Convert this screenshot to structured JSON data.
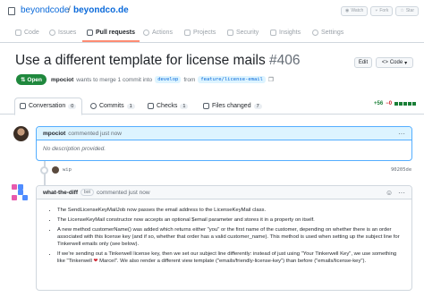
{
  "repo": {
    "owner": "beyondcode",
    "separator": "/",
    "name": "beyondco.de",
    "buttons": [
      "Watch",
      "Fork",
      "Star"
    ]
  },
  "repo_tabs": [
    {
      "label": "Code",
      "icon": "code-icon"
    },
    {
      "label": "Issues",
      "icon": "issue-icon"
    },
    {
      "label": "Pull requests",
      "icon": "pull-request-icon",
      "active": true
    },
    {
      "label": "Actions",
      "icon": "play-icon"
    },
    {
      "label": "Projects",
      "icon": "table-icon"
    },
    {
      "label": "Security",
      "icon": "shield-icon"
    },
    {
      "label": "Insights",
      "icon": "graph-icon"
    },
    {
      "label": "Settings",
      "icon": "gear-icon"
    }
  ],
  "pr": {
    "title": "Use a different template for license mails",
    "number": "#406",
    "edit_label": "Edit",
    "code_label": "Code",
    "state": "Open",
    "author": "mpociot",
    "meta_text": "wants to merge 1 commit into",
    "base_branch": "develop",
    "from_text": "from",
    "head_branch": "feature/license-email"
  },
  "pr_tabs": [
    {
      "label": "Conversation",
      "count": "0"
    },
    {
      "label": "Commits",
      "count": "1"
    },
    {
      "label": "Checks",
      "count": "1"
    },
    {
      "label": "Files changed",
      "count": "7"
    }
  ],
  "diffstat": {
    "additions": "+56",
    "deletions": "−0"
  },
  "comments": [
    {
      "author": "mpociot",
      "meta": "commented just now",
      "body": "No description provided."
    },
    {
      "author": "what-the-diff",
      "badge": "bot",
      "meta": "commented just now",
      "items": [
        "The SendLicenseKeyMailJob now passes the email address to the LicenseKeyMail class.",
        "The LicenseKeyMail constructor now accepts an optional $email parameter and stores it in a property on itself.",
        "A new method customerName() was added which returns either \"you\" or the first name of the customer, depending on whether there is an order associated with this license key (and if so, whether that order has a valid customer_name). This method is used when setting up the subject line for Tinkerwell emails only (see below).",
        "If we're sending out a Tinkerwell license key, then we set our subject line differently: instead of just using \"Your Tinkerwell Key\", we use something like \"Tinkerwell ❤ Marcel\". We also render a different view template (\"emails/friendly-license-key\") than before (\"emails/license-key\")."
      ]
    }
  ],
  "commit": {
    "message": "wip",
    "sha": "90205de"
  }
}
